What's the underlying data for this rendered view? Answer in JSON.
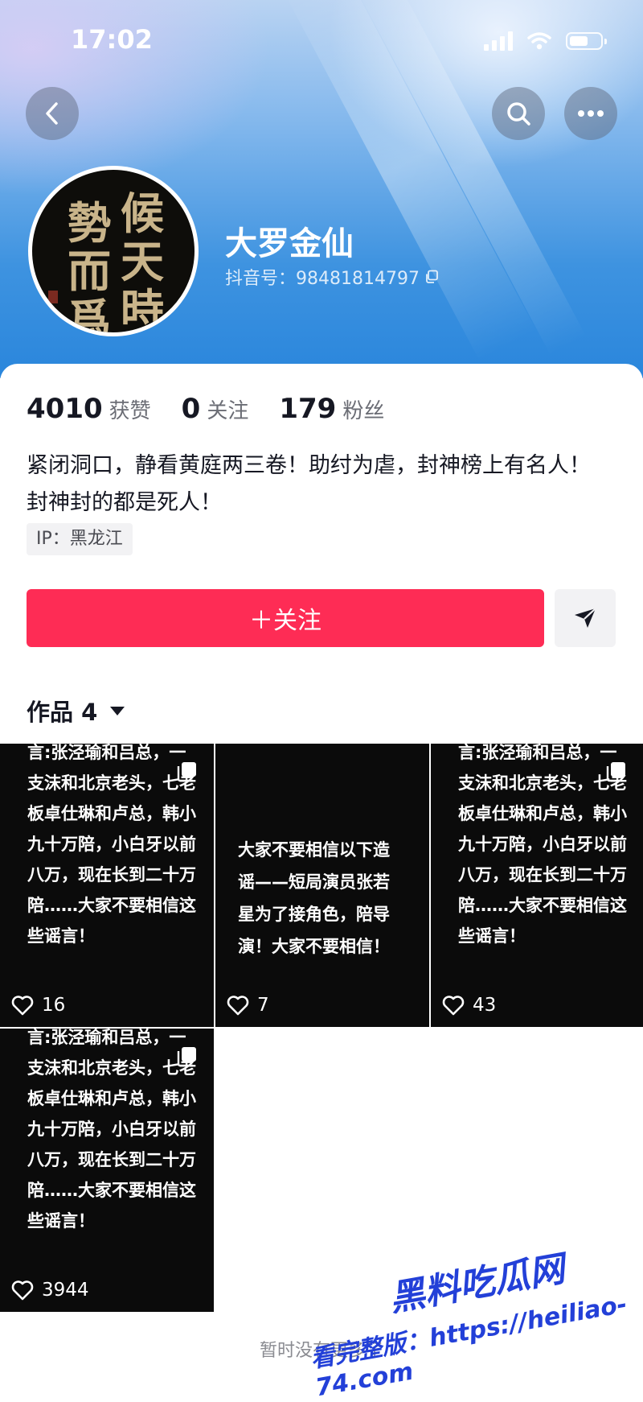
{
  "status_bar": {
    "time": "17:02"
  },
  "profile": {
    "name": "大罗金仙",
    "douyin_id": "抖音号：98481814797",
    "avatar_chars": [
      "候",
      "天",
      "時",
      "勢",
      "而",
      "爲"
    ],
    "stats": [
      {
        "value": "4010",
        "label": "获赞"
      },
      {
        "value": "0",
        "label": "关注"
      },
      {
        "value": "179",
        "label": "粉丝"
      }
    ],
    "bio": "紧闭洞口，静看黄庭两三卷！助纣为虐，封神榜上有名人！封神封的都是死人！",
    "ip": "IP：黑龙江"
  },
  "actions": {
    "follow_label": "＋关注"
  },
  "works_tab": {
    "label": "作品 4"
  },
  "videos": [
    {
      "text": "言:张泾瑜和吕总，一\n支沫和北京老头，七老\n板卓仕琳和卢总，韩小\n九十万陪，小白牙以前\n八万，现在长到二十万\n陪……大家不要相信这\n些谣言！",
      "likes": "16"
    },
    {
      "text": "大家不要相信以下造\n谣——短局演员张若\n星为了接角色，陪导\n演！大家不要相信！",
      "likes": "7"
    },
    {
      "text": "言:张泾瑜和吕总，一\n支沫和北京老头，七老\n板卓仕琳和卢总，韩小\n九十万陪，小白牙以前\n八万，现在长到二十万\n陪……大家不要相信这\n些谣言！",
      "likes": "43"
    },
    {
      "text": "言:张泾瑜和吕总，一\n支沫和北京老头，七老\n板卓仕琳和卢总，韩小\n九十万陪，小白牙以前\n八万，现在长到二十万\n陪……大家不要相信这\n些谣言！",
      "likes": "3944"
    }
  ],
  "footer": {
    "no_more": "暂时没有更多了"
  },
  "watermark": {
    "title": "黑料吃瓜网",
    "url": "看完整版：https://heiliao-74.com"
  },
  "colors": {
    "accent": "#fe2c55",
    "header_blue": "#2a86dc",
    "watermark": "#2340d8"
  }
}
